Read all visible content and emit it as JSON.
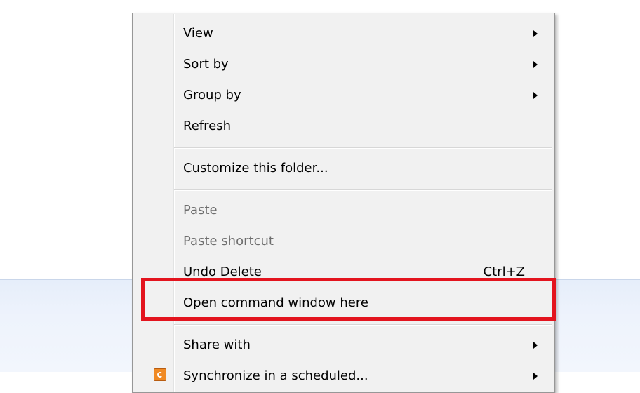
{
  "context_menu": {
    "items": [
      {
        "label": "View",
        "submenu": true,
        "enabled": true
      },
      {
        "label": "Sort by",
        "submenu": true,
        "enabled": true
      },
      {
        "label": "Group by",
        "submenu": true,
        "enabled": true
      },
      {
        "label": "Refresh",
        "submenu": false,
        "enabled": true
      },
      {
        "label": "Customize this folder...",
        "submenu": false,
        "enabled": true
      },
      {
        "label": "Paste",
        "submenu": false,
        "enabled": false
      },
      {
        "label": "Paste shortcut",
        "submenu": false,
        "enabled": false
      },
      {
        "label": "Undo Delete",
        "shortcut": "Ctrl+Z",
        "submenu": false,
        "enabled": true
      },
      {
        "label": "Open command window here",
        "submenu": false,
        "enabled": true,
        "highlighted": true
      },
      {
        "label": "Share with",
        "submenu": true,
        "enabled": true
      },
      {
        "label": "Synchronize in a scheduled...",
        "submenu": true,
        "enabled": true,
        "icon": "sync-app-icon"
      }
    ]
  },
  "colors": {
    "menu_background": "#f1f1f1",
    "disabled_text": "#6d6d6d",
    "annotation_red": "#e3141e",
    "band_background": "#e6eefa"
  }
}
